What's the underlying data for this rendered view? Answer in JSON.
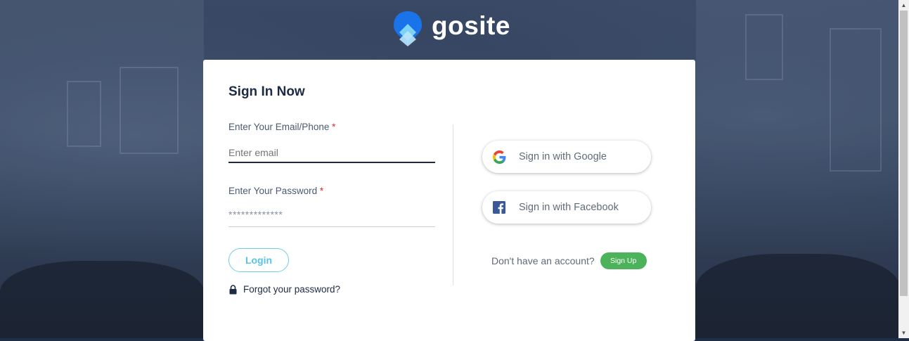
{
  "brand": {
    "name": "gosite"
  },
  "signin": {
    "title": "Sign In Now",
    "email_label": "Enter Your Email/Phone",
    "email_placeholder": "Enter email",
    "password_label": "Enter Your Password",
    "password_value": "*************",
    "required_mark": "*",
    "login_label": "Login",
    "forgot_label": "Forgot your password?"
  },
  "social": {
    "google_label": "Sign in with Google",
    "facebook_label": "Sign in with Facebook"
  },
  "signup": {
    "prompt": "Don't have an account?",
    "button_label": "Sign Up"
  },
  "colors": {
    "accent": "#56c4e6",
    "title": "#1d2b45",
    "signup": "#4cb35a",
    "required": "#e0292b",
    "facebook": "#3b5998"
  }
}
